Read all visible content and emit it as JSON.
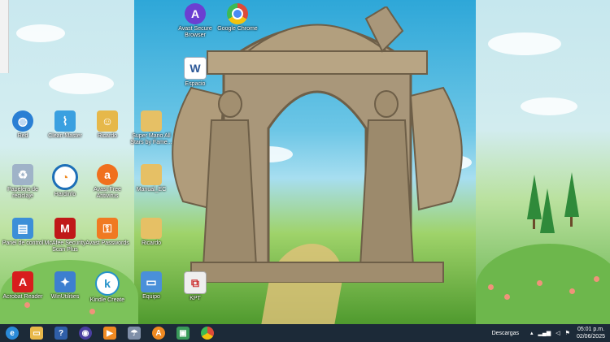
{
  "desktop": {
    "icons": [
      {
        "label": "Avast Secure Browser",
        "icon": "avast-browser-icon",
        "color": "#6b3fd1"
      },
      {
        "label": "Google Chrome",
        "icon": "chrome-icon",
        "color": "#dd4b39"
      },
      {
        "label": "Espacio",
        "icon": "word-doc-icon",
        "color": "#2b5797"
      },
      {
        "label": "Red",
        "icon": "network-icon",
        "color": "#2a7fd4"
      },
      {
        "label": "Clean Master",
        "icon": "broom-icon",
        "color": "#3aa0e0"
      },
      {
        "label": "Ricardo",
        "icon": "user-folder-icon",
        "color": "#e6b84a"
      },
      {
        "label": "Super Mario All Stars by Fame...",
        "icon": "folder-icon",
        "color": "#e6c065"
      },
      {
        "label": "Papelera de reciclaje",
        "icon": "recycle-bin-icon",
        "color": "#9fb3c8"
      },
      {
        "label": "Hardinfo",
        "icon": "hardinfo-icon",
        "color": "#1d6fb8"
      },
      {
        "label": "Avast Free Antivirus",
        "icon": "avast-icon",
        "color": "#f0701e"
      },
      {
        "label": "Manual_EC",
        "icon": "folder-icon",
        "color": "#e6c065"
      },
      {
        "label": "Panel de control",
        "icon": "control-panel-icon",
        "color": "#3c8fd8"
      },
      {
        "label": "McAfee Security Scan Plus",
        "icon": "mcafee-icon",
        "color": "#c01818"
      },
      {
        "label": "Avast Passwords",
        "icon": "avast-passwords-icon",
        "color": "#f07a22"
      },
      {
        "label": "Ricardo",
        "icon": "folder-icon",
        "color": "#e6c065"
      },
      {
        "label": "Acrobat Reader",
        "icon": "acrobat-icon",
        "color": "#d81d1d"
      },
      {
        "label": "WinUtilities",
        "icon": "winutilities-icon",
        "color": "#3d7fd0"
      },
      {
        "label": "Kindle Create",
        "icon": "kindle-icon",
        "color": "#2592c9"
      },
      {
        "label": "Equipo",
        "icon": "computer-icon",
        "color": "#4a90d9"
      },
      {
        "label": "KPT",
        "icon": "pdf-file-icon",
        "color": "#d9d9d9"
      }
    ]
  },
  "taskbar": {
    "apps": [
      {
        "icon": "internet-explorer-icon",
        "glyph": "e",
        "color": "#2a8ad8"
      },
      {
        "icon": "file-explorer-icon",
        "glyph": "▭",
        "color": "#e8b84a"
      },
      {
        "icon": "help-icon",
        "glyph": "?",
        "color": "#2f5fa8"
      },
      {
        "icon": "firefox-icon",
        "glyph": "◉",
        "color": "#4a3fa0"
      },
      {
        "icon": "media-player-icon",
        "glyph": "▶",
        "color": "#f08a22"
      },
      {
        "icon": "weather-app-icon",
        "glyph": "☂",
        "color": "#7f8fa8"
      },
      {
        "icon": "avast-browser-icon",
        "glyph": "A",
        "color": "#f08a22"
      },
      {
        "icon": "window-icon",
        "glyph": "▣",
        "color": "#3a9a5a"
      },
      {
        "icon": "chrome-icon",
        "glyph": "●",
        "color": "#dd4b39"
      }
    ],
    "descargas_label": "Descargas",
    "time": "05:01 p.m.",
    "date": "02/06/2025"
  }
}
